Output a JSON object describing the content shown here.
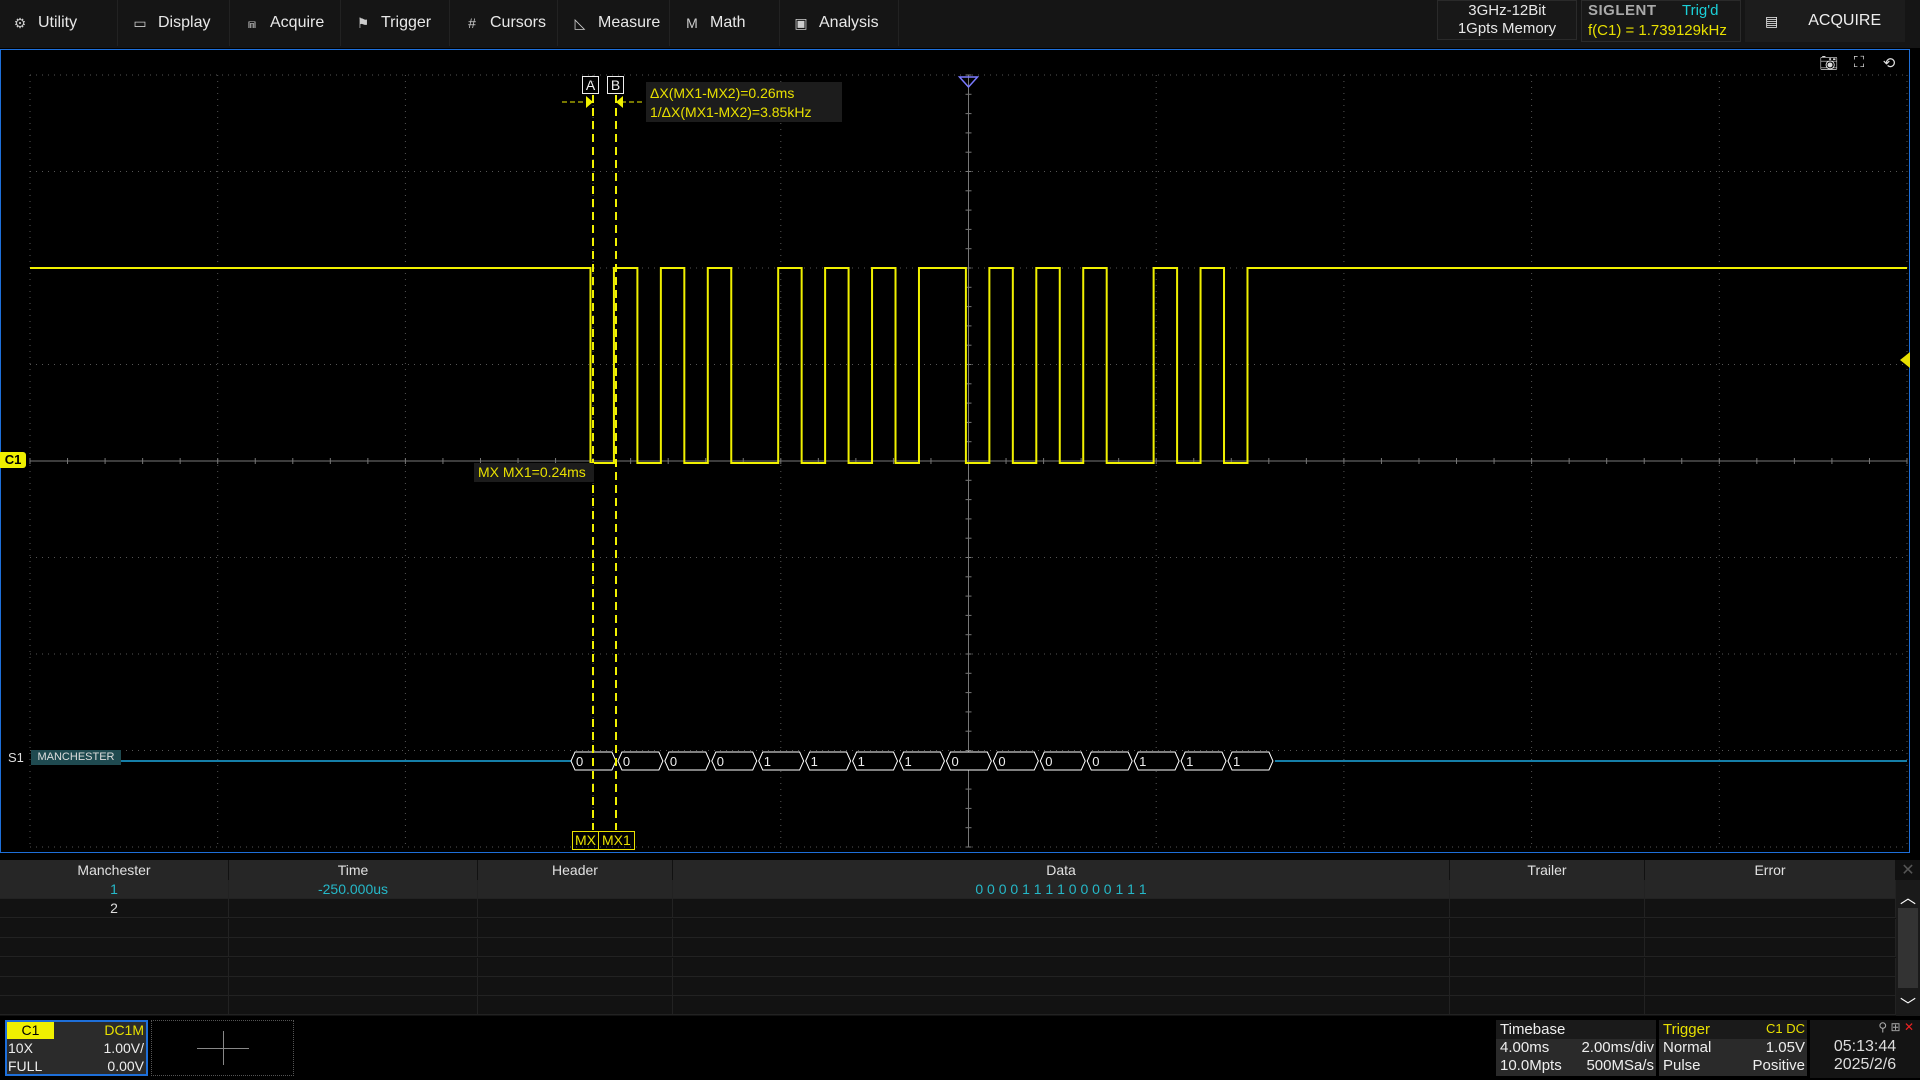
{
  "menu": [
    {
      "label": "Utility",
      "icon": "gear-icon",
      "glyph": "⚙"
    },
    {
      "label": "Display",
      "icon": "monitor-icon",
      "glyph": "▭"
    },
    {
      "label": "Acquire",
      "icon": "acquire-icon",
      "glyph": "⩎"
    },
    {
      "label": "Trigger",
      "icon": "flag-icon",
      "glyph": "⚑"
    },
    {
      "label": "Cursors",
      "icon": "cursors-icon",
      "glyph": "#"
    },
    {
      "label": "Measure",
      "icon": "ruler-icon",
      "glyph": "◺"
    },
    {
      "label": "Math",
      "icon": "math-icon",
      "glyph": "M"
    },
    {
      "label": "Analysis",
      "icon": "analysis-icon",
      "glyph": "▣"
    }
  ],
  "spec": {
    "line1": "3GHz-12Bit",
    "line2": "1Gpts Memory"
  },
  "status": {
    "brand": "SIGLENT",
    "trigger_state": "Trig'd",
    "frequency": "f(C1) = 1.739129kHz",
    "acquire_label": "ACQUIRE"
  },
  "colors": {
    "channel1": "#f0f000",
    "bus": "#1ca8e0",
    "accent": "#1e6fd9",
    "cyan": "#25b8c8"
  },
  "cursors": {
    "a_label": "A",
    "b_label": "B",
    "delta": "ΔX(MX1-MX2)=0.26ms",
    "inverse": "1/ΔX(MX1-MX2)=3.85kHz",
    "mx1_readout": "MX MX1=0.24ms",
    "bottom_label_1": "MX",
    "bottom_label_2": "MX1"
  },
  "channel_marker": "C1",
  "bus": {
    "id": "S1",
    "protocol": "MANCHESTER",
    "bits": [
      0,
      0,
      0,
      0,
      1,
      1,
      1,
      1,
      0,
      0,
      0,
      0,
      1,
      1,
      1
    ]
  },
  "table": {
    "headers": [
      "Manchester",
      "Time",
      "Header",
      "Data",
      "Trailer",
      "Error"
    ],
    "rows": [
      {
        "index": "1",
        "time": "-250.000us",
        "header": "",
        "data": "0 0 0 0 1 1 1 1 0 0 0 0 1 1 1",
        "trailer": "",
        "error": ""
      },
      {
        "index": "2",
        "time": "",
        "header": "",
        "data": "",
        "trailer": "",
        "error": ""
      }
    ]
  },
  "ch1": {
    "name": "C1",
    "coupling": "DC1M",
    "probe": "10X",
    "scale": "1.00V/",
    "bandwidth": "FULL",
    "offset": "0.00V"
  },
  "timebase": {
    "title": "Timebase",
    "delay": "4.00ms",
    "scale": "2.00ms/div",
    "points": "10.0Mpts",
    "rate": "500MSa/s"
  },
  "trigger": {
    "title": "Trigger",
    "source": "C1 DC",
    "mode": "Normal",
    "level": "1.05V",
    "type": "Pulse",
    "polarity": "Positive"
  },
  "clock": {
    "time": "05:13:44",
    "date": "2025/2/6"
  }
}
